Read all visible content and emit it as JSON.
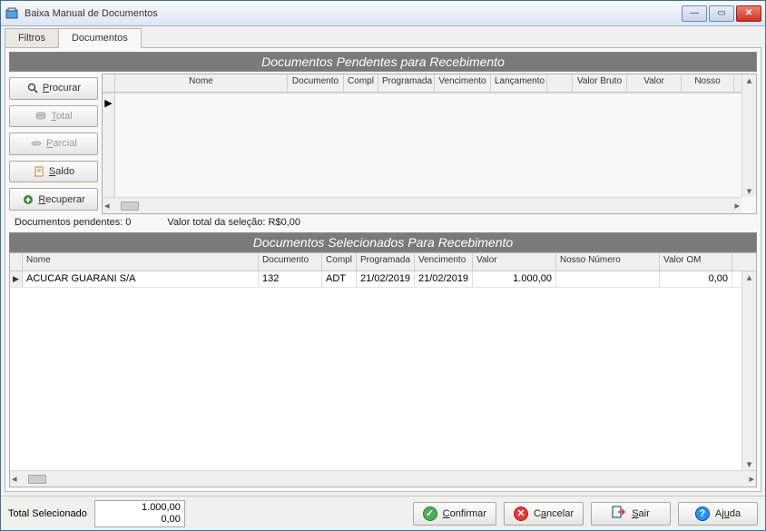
{
  "window": {
    "title": "Baixa Manual de Documentos"
  },
  "tabs": {
    "filtros": "Filtros",
    "documentos": "Documentos"
  },
  "section_pendentes": "Documentos Pendentes para Recebimento",
  "sidebar": {
    "procurar": "Procurar",
    "total": "Total",
    "parcial": "Parcial",
    "saldo": "Saldo",
    "recuperar": "Recuperar"
  },
  "grid1_headers": {
    "nome": "Nome",
    "documento": "Documento",
    "compl": "Compl",
    "programada": "Programada",
    "vencimento": "Vencimento",
    "lancamento": "Lançamento",
    "blank": "",
    "valor_bruto": "Valor Bruto",
    "valor": "Valor",
    "nosso": "Nosso"
  },
  "status": {
    "docs_pendentes_label": "Documentos pendentes: 0",
    "valor_total_label": "Valor total da seleção: R$0,00"
  },
  "section_selecionados": "Documentos Selecionados Para Recebimento",
  "grid2_headers": {
    "nome": "Nome",
    "documento": "Documento",
    "compl": "Compl",
    "programada": "Programada",
    "vencimento": "Vencimento",
    "valor": "Valor",
    "nosso_numero": "Nosso Número",
    "valor_om": "Valor OM"
  },
  "grid2_row": {
    "nome": "ACUCAR GUARANI S/A",
    "documento": "132",
    "compl": "ADT",
    "programada": "21/02/2019",
    "vencimento": "21/02/2019",
    "valor": "1.000,00",
    "nosso_numero": "",
    "valor_om": "0,00"
  },
  "footer": {
    "total_label": "Total Selecionado",
    "total_value": "1.000,00",
    "total_sub": "0,00",
    "confirmar": "Confirmar",
    "cancelar": "Cancelar",
    "sair": "Sair",
    "ajuda": "Ajuda"
  }
}
